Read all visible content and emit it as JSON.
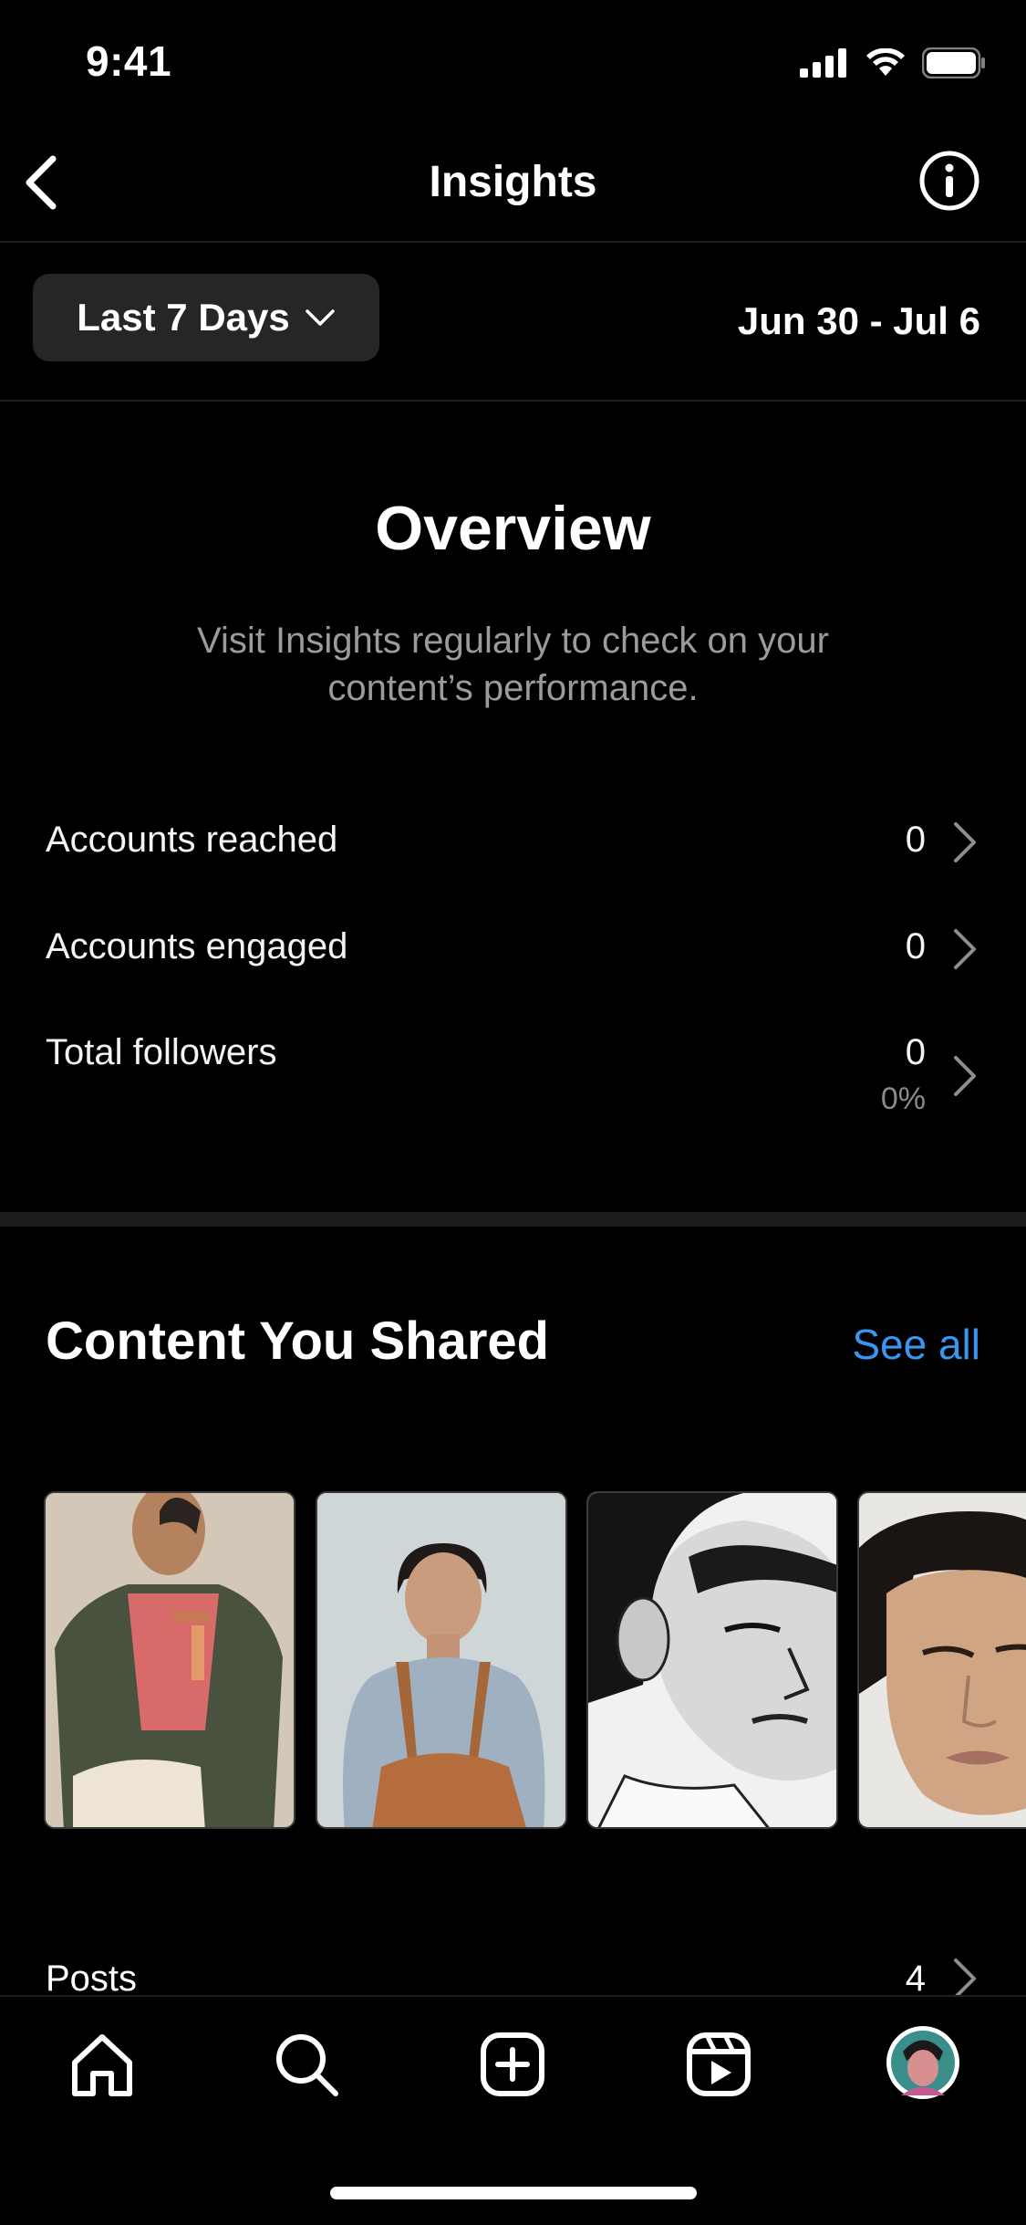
{
  "status_bar": {
    "time": "9:41"
  },
  "header": {
    "title": "Insights"
  },
  "range": {
    "label": "Last 7 Days",
    "dates": "Jun 30 - Jul 6"
  },
  "overview": {
    "title": "Overview",
    "description": "Visit Insights regularly to check on your content’s performance.",
    "metrics": [
      {
        "label": "Accounts reached",
        "value": "0"
      },
      {
        "label": "Accounts engaged",
        "value": "0"
      },
      {
        "label": "Total followers",
        "value": "0",
        "change": "0%"
      }
    ]
  },
  "content": {
    "title": "Content You Shared",
    "see_all": "See all",
    "thumbnails": [
      {
        "icon": "portrait-green-jacket",
        "bg": "#cfc5b6"
      },
      {
        "icon": "portrait-blue-shirt",
        "bg": "#c9d1d4"
      },
      {
        "icon": "portrait-sketch",
        "bg": "#e6e6e6"
      },
      {
        "icon": "portrait-closeup",
        "bg": "#d9c0a8"
      }
    ],
    "posts": {
      "label": "Posts",
      "value": "4"
    }
  },
  "tabbar": {
    "items": [
      "home-icon",
      "search-icon",
      "create-icon",
      "reels-icon",
      "profile-avatar"
    ]
  },
  "colors": {
    "accent": "#3897f0",
    "background": "#000000",
    "button": "#262626"
  }
}
